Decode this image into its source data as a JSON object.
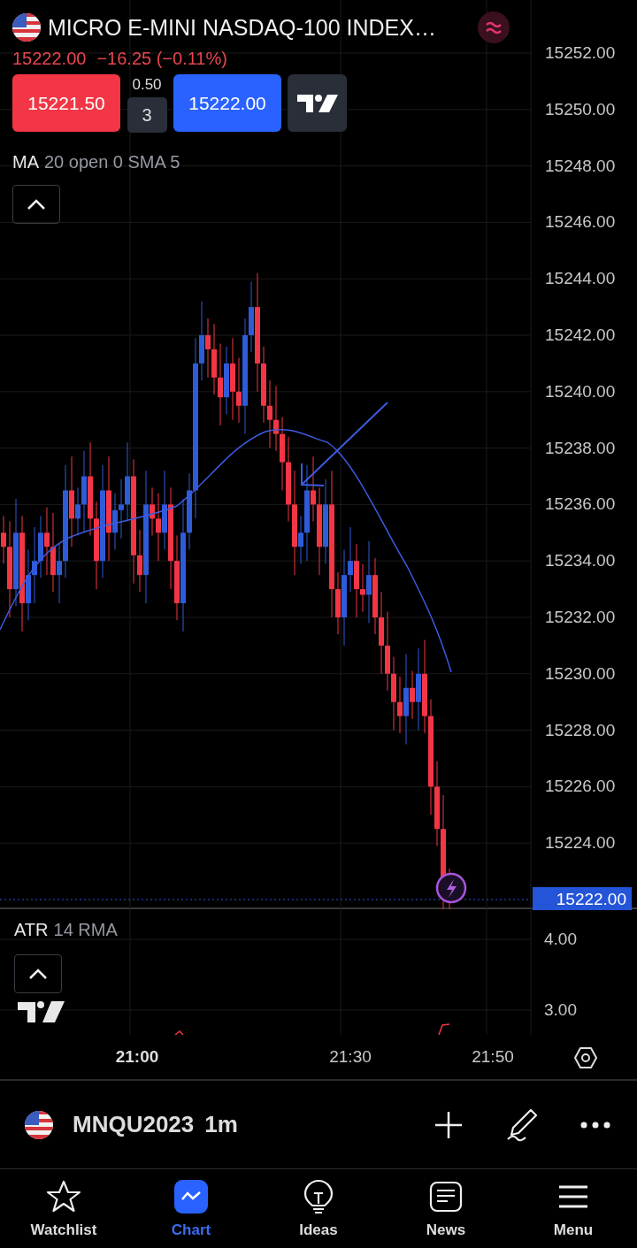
{
  "symbol": {
    "title": "MICRO E-MINI NASDAQ-100 INDEX…",
    "price": "15222.00",
    "change": "−16.25 (−0.11%)"
  },
  "trade": {
    "sell": "15221.50",
    "spread": "0.50",
    "quantity": "3",
    "buy": "15222.00"
  },
  "indicator": {
    "name": "MA",
    "params": "20 open 0 SMA 5"
  },
  "price_axis": [
    "15252.00",
    "15250.00",
    "15248.00",
    "15246.00",
    "15244.00",
    "15242.00",
    "15240.00",
    "15238.00",
    "15236.00",
    "15234.00",
    "15232.00",
    "15230.00",
    "15228.00",
    "15226.00",
    "15224.00"
  ],
  "current_price": "15222.00",
  "atr": {
    "name": "ATR",
    "params": "14 RMA",
    "axis": [
      "4.00",
      "3.00"
    ]
  },
  "time_axis": [
    {
      "label": "21:00",
      "bold": true
    },
    {
      "label": "21:30",
      "bold": false
    },
    {
      "label": "21:50",
      "bold": false
    }
  ],
  "symbol_bar": {
    "ticker": "MNQU2023",
    "interval": "1m"
  },
  "nav": [
    {
      "label": "Watchlist",
      "selected": false
    },
    {
      "label": "Chart",
      "selected": true
    },
    {
      "label": "Ideas",
      "selected": false
    },
    {
      "label": "News",
      "selected": false
    },
    {
      "label": "Menu",
      "selected": false
    }
  ]
}
